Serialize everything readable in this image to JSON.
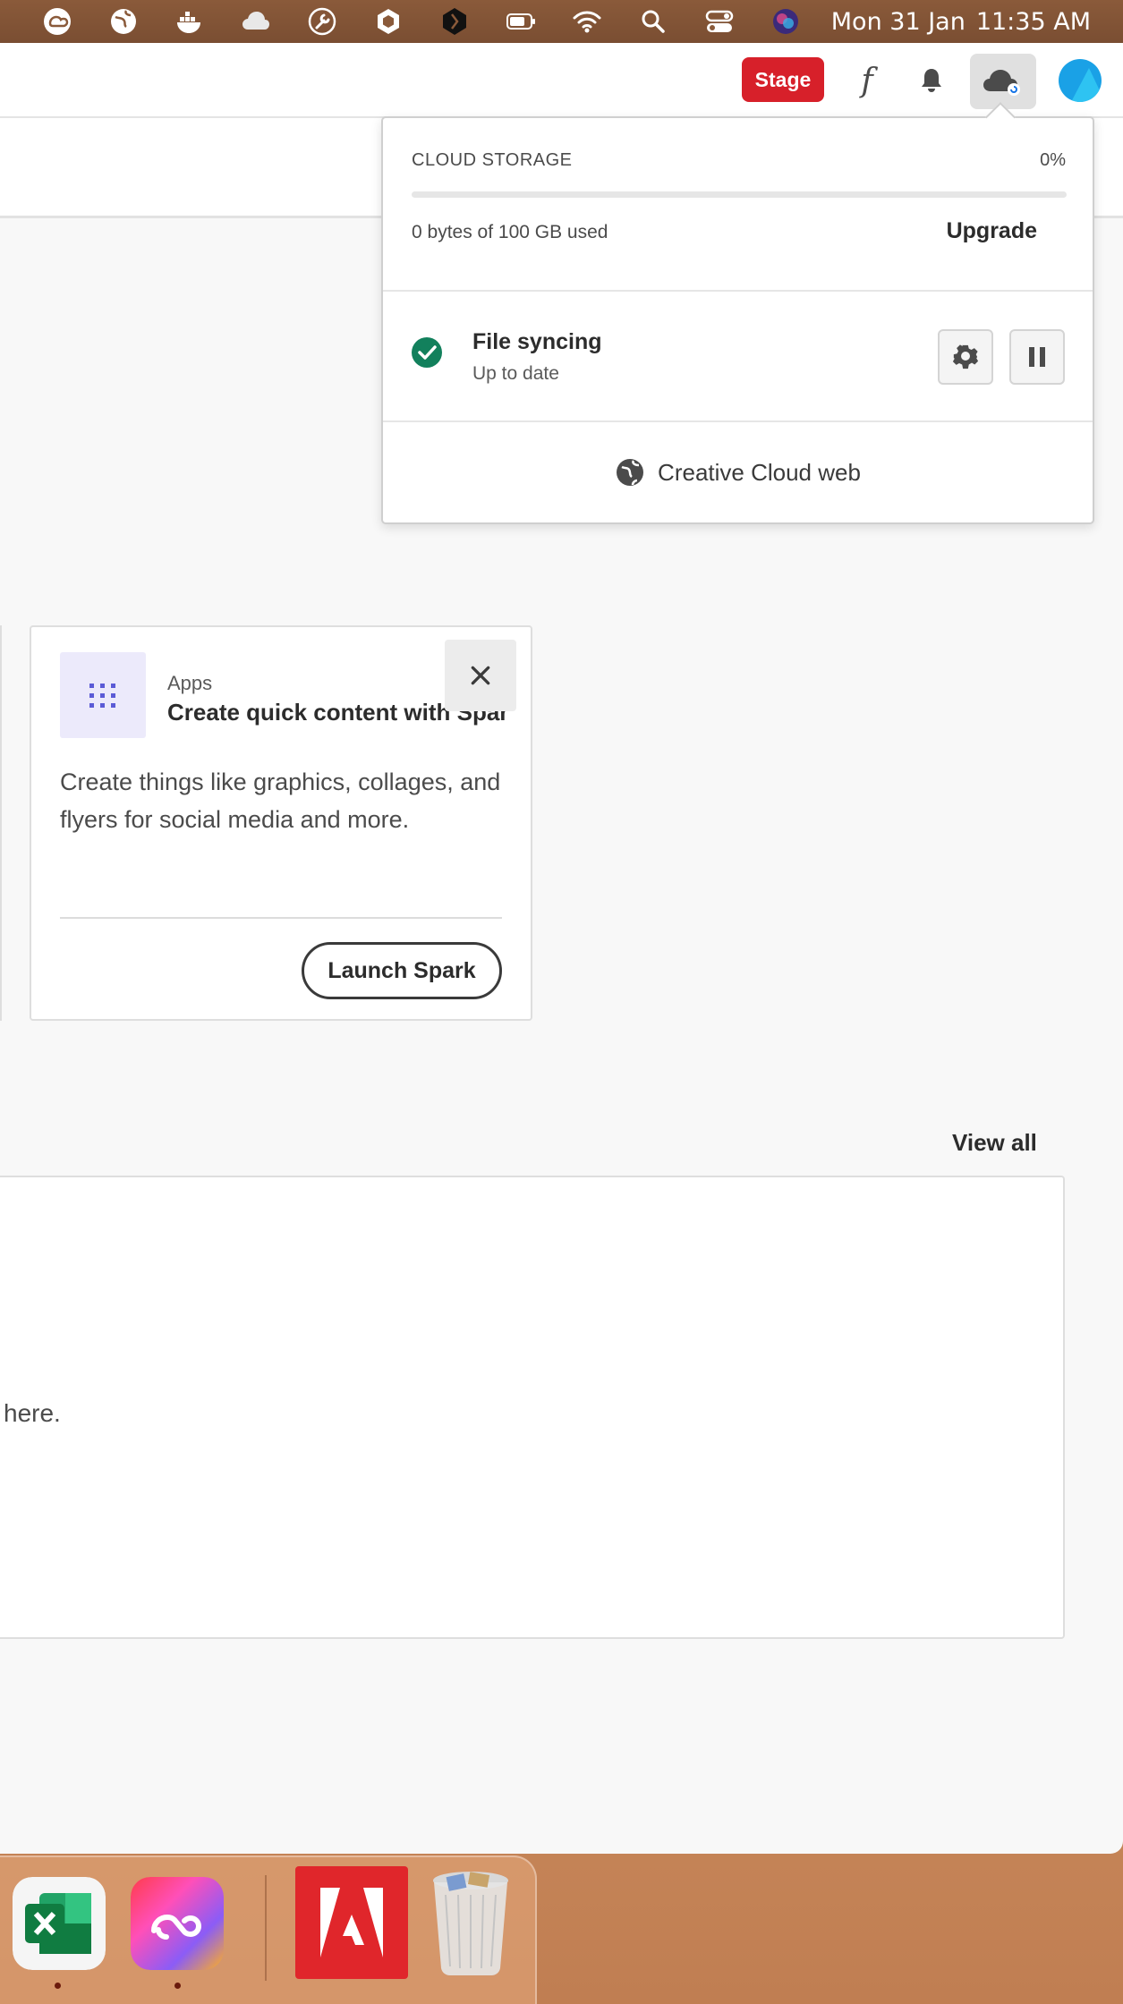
{
  "menubar": {
    "icons": [
      "creative-cloud-icon",
      "globe-icon",
      "docker-icon",
      "cloud-icon",
      "wrench-icon",
      "hexagon-icon",
      "dark-hexagon-icon",
      "battery-icon",
      "wifi-icon",
      "spotlight-icon",
      "control-center-icon",
      "siri-icon"
    ],
    "date": "Mon 31 Jan",
    "time": "11:35 AM"
  },
  "topbar": {
    "stage_label": "Stage",
    "fonts_glyph": "f"
  },
  "popover": {
    "storage_title": "CLOUD STORAGE",
    "storage_percent_label": "0%",
    "storage_percent_value": 0,
    "storage_used": "0 bytes of 100 GB used",
    "upgrade_label": "Upgrade",
    "sync_title": "File syncing",
    "sync_status": "Up to date",
    "web_link_label": "Creative Cloud web"
  },
  "card": {
    "category": "Apps",
    "title": "Create quick content with Spark",
    "description": "Create things like graphics, collages, and flyers for social media and more.",
    "launch_label": "Launch Spark"
  },
  "files": {
    "view_all_label": "View all",
    "empty_text": "here."
  },
  "dock": {
    "apps": [
      "Microsoft Excel",
      "Creative Cloud",
      "Adobe",
      "Trash"
    ]
  },
  "colors": {
    "stage": "#d7202a",
    "sync_ok": "#12805c",
    "accent": "#1473e6",
    "avatar": "#1aa1e6"
  }
}
